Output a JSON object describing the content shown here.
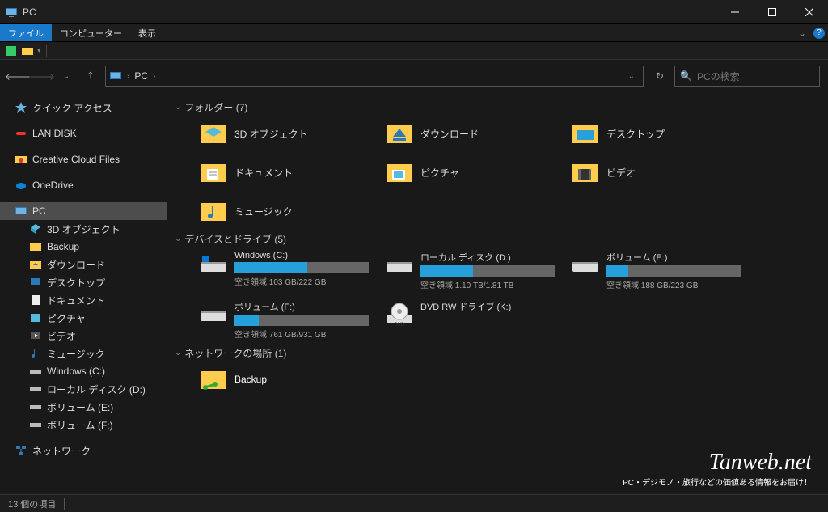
{
  "window": {
    "title": "PC"
  },
  "menu": {
    "file": "ファイル",
    "computer": "コンピューター",
    "view": "表示"
  },
  "address": {
    "location": "PC",
    "separator": "›"
  },
  "search": {
    "placeholder": "PCの検索"
  },
  "sidebar": {
    "quick_access": "クイック アクセス",
    "lan_disk": "LAN DISK",
    "creative_cloud": "Creative Cloud Files",
    "onedrive": "OneDrive",
    "pc": "PC",
    "pc_children": [
      "3D オブジェクト",
      "Backup",
      "ダウンロード",
      "デスクトップ",
      "ドキュメント",
      "ピクチャ",
      "ビデオ",
      "ミュージック",
      "Windows (C:)",
      "ローカル ディスク (D:)",
      "ボリューム (E:)",
      "ボリューム (F:)"
    ],
    "network": "ネットワーク"
  },
  "groups": {
    "folders": {
      "header": "フォルダー (7)",
      "items": [
        "3D オブジェクト",
        "ダウンロード",
        "デスクトップ",
        "ドキュメント",
        "ピクチャ",
        "ビデオ",
        "ミュージック"
      ]
    },
    "drives": {
      "header": "デバイスとドライブ (5)",
      "items": [
        {
          "name": "Windows (C:)",
          "free_text": "空き領域 103 GB/222 GB",
          "fill_pct": 54
        },
        {
          "name": "ローカル ディスク (D:)",
          "free_text": "空き領域 1.10 TB/1.81 TB",
          "fill_pct": 39
        },
        {
          "name": "ボリューム (E:)",
          "free_text": "空き領域 188 GB/223 GB",
          "fill_pct": 16
        },
        {
          "name": "ボリューム (F:)",
          "free_text": "空き領域 761 GB/931 GB",
          "fill_pct": 18
        },
        {
          "name": "DVD RW ドライブ (K:)",
          "free_text": "",
          "fill_pct": null
        }
      ]
    },
    "network": {
      "header": "ネットワークの場所 (1)",
      "items": [
        "Backup"
      ]
    }
  },
  "status": {
    "item_count": "13 個の項目"
  },
  "watermark": {
    "big": "Tanweb.net",
    "small": "PC・デジモノ・旅行などの価値ある情報をお届け！"
  }
}
